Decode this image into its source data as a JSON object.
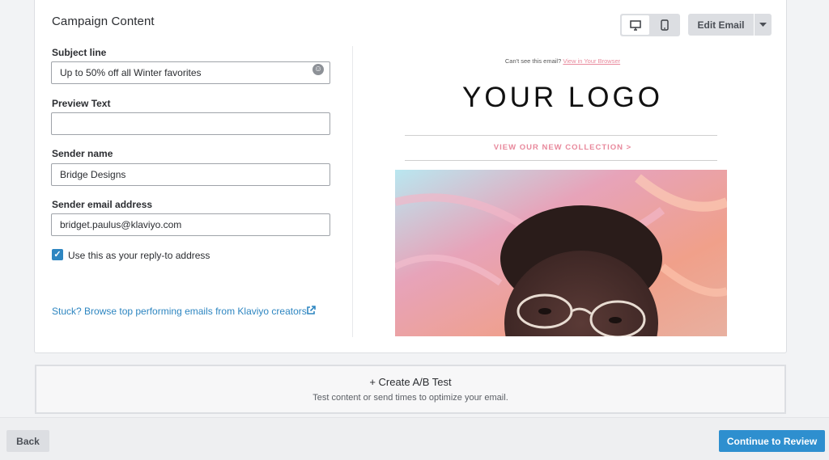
{
  "campaign": {
    "title": "Campaign Content"
  },
  "form": {
    "subject": {
      "label": "Subject line",
      "value": "Up to 50% off all Winter favorites"
    },
    "preview_text": {
      "label": "Preview Text",
      "value": ""
    },
    "sender_name": {
      "label": "Sender name",
      "value": "Bridge Designs"
    },
    "sender_email": {
      "label": "Sender email address",
      "value": "bridget.paulus@klaviyo.com"
    },
    "reply_to": {
      "label": "Use this as your reply-to address",
      "checked": true
    }
  },
  "stuck_link": "Stuck? Browse top performing emails from Klaviyo creators",
  "toolbar": {
    "edit_label": "Edit Email",
    "view_mode": "desktop"
  },
  "email_preview": {
    "cant_see": "Can't see this email?",
    "view_in_browser": "View in Your Browser",
    "logo": "YOUR LOGO",
    "collection_link": "VIEW OUR NEW COLLECTION >",
    "accent_color": "#e8899c"
  },
  "ab_test": {
    "title": "+ Create A/B Test",
    "subtitle": "Test content or send times to optimize your email."
  },
  "footer": {
    "back_label": "Back",
    "continue_label": "Continue to Review"
  },
  "colors": {
    "primary": "#2e8fcf"
  },
  "icons": [
    "emoji-icon",
    "external-link-icon",
    "desktop-icon",
    "mobile-icon",
    "chevron-down-icon",
    "check-icon"
  ]
}
